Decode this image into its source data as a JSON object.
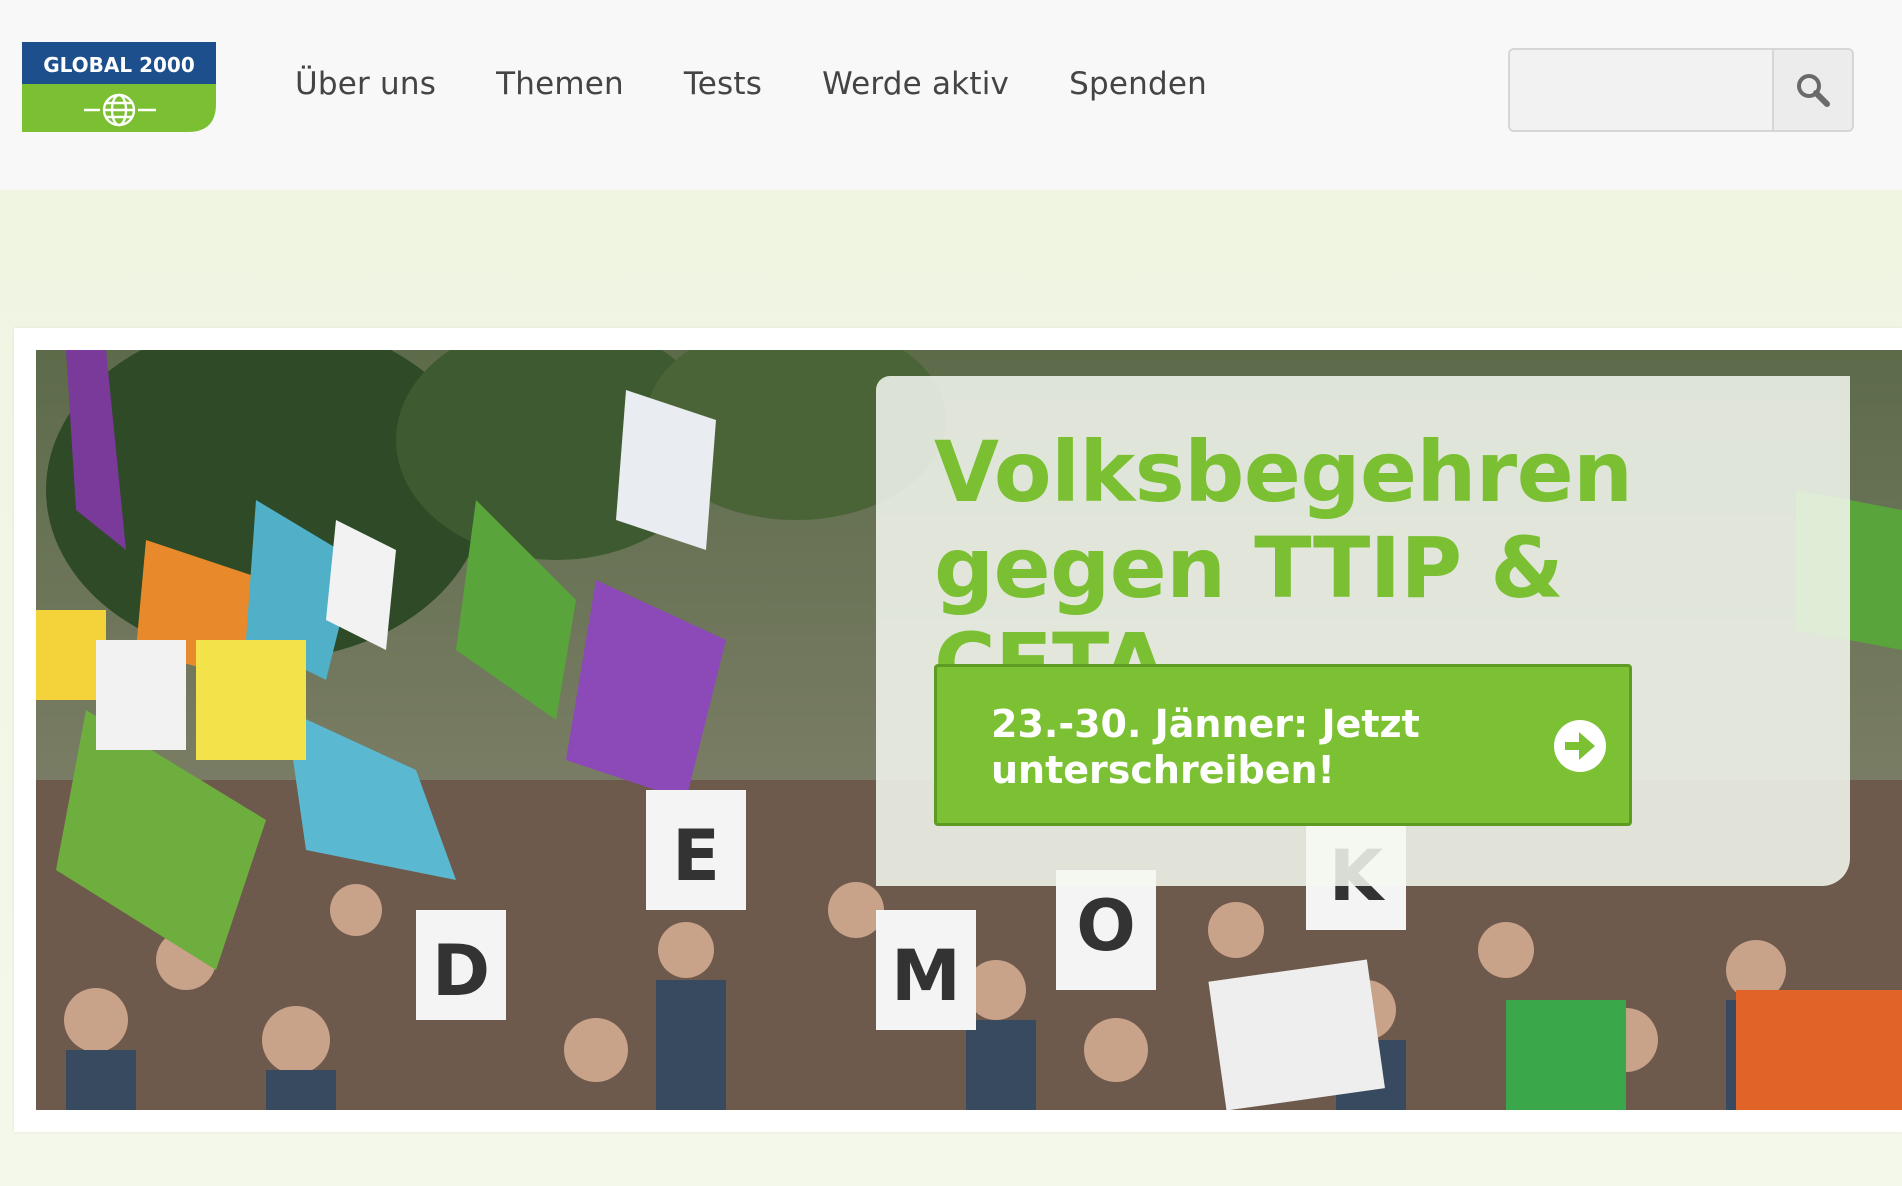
{
  "brand": {
    "logo_text": "GLOBAL 2000",
    "colors": {
      "navy": "#1d4f8c",
      "green": "#7ac032",
      "header_bg": "#f8f8f8"
    }
  },
  "nav": {
    "items": [
      {
        "label": "Über uns"
      },
      {
        "label": "Themen"
      },
      {
        "label": "Tests"
      },
      {
        "label": "Werde aktiv"
      },
      {
        "label": "Spenden"
      }
    ]
  },
  "search": {
    "value": "",
    "placeholder": "",
    "icon": "search-icon"
  },
  "hero": {
    "headline_line1": "Volksbegehren",
    "headline_line2": "gegen TTIP & CETA",
    "cta_line1": "23.-30. Jänner: Jetzt",
    "cta_line2": "unterschreiben!",
    "cta_icon": "arrow-right-circle-icon",
    "photo_letters": [
      "D",
      "E",
      "M",
      "O",
      "K"
    ]
  }
}
